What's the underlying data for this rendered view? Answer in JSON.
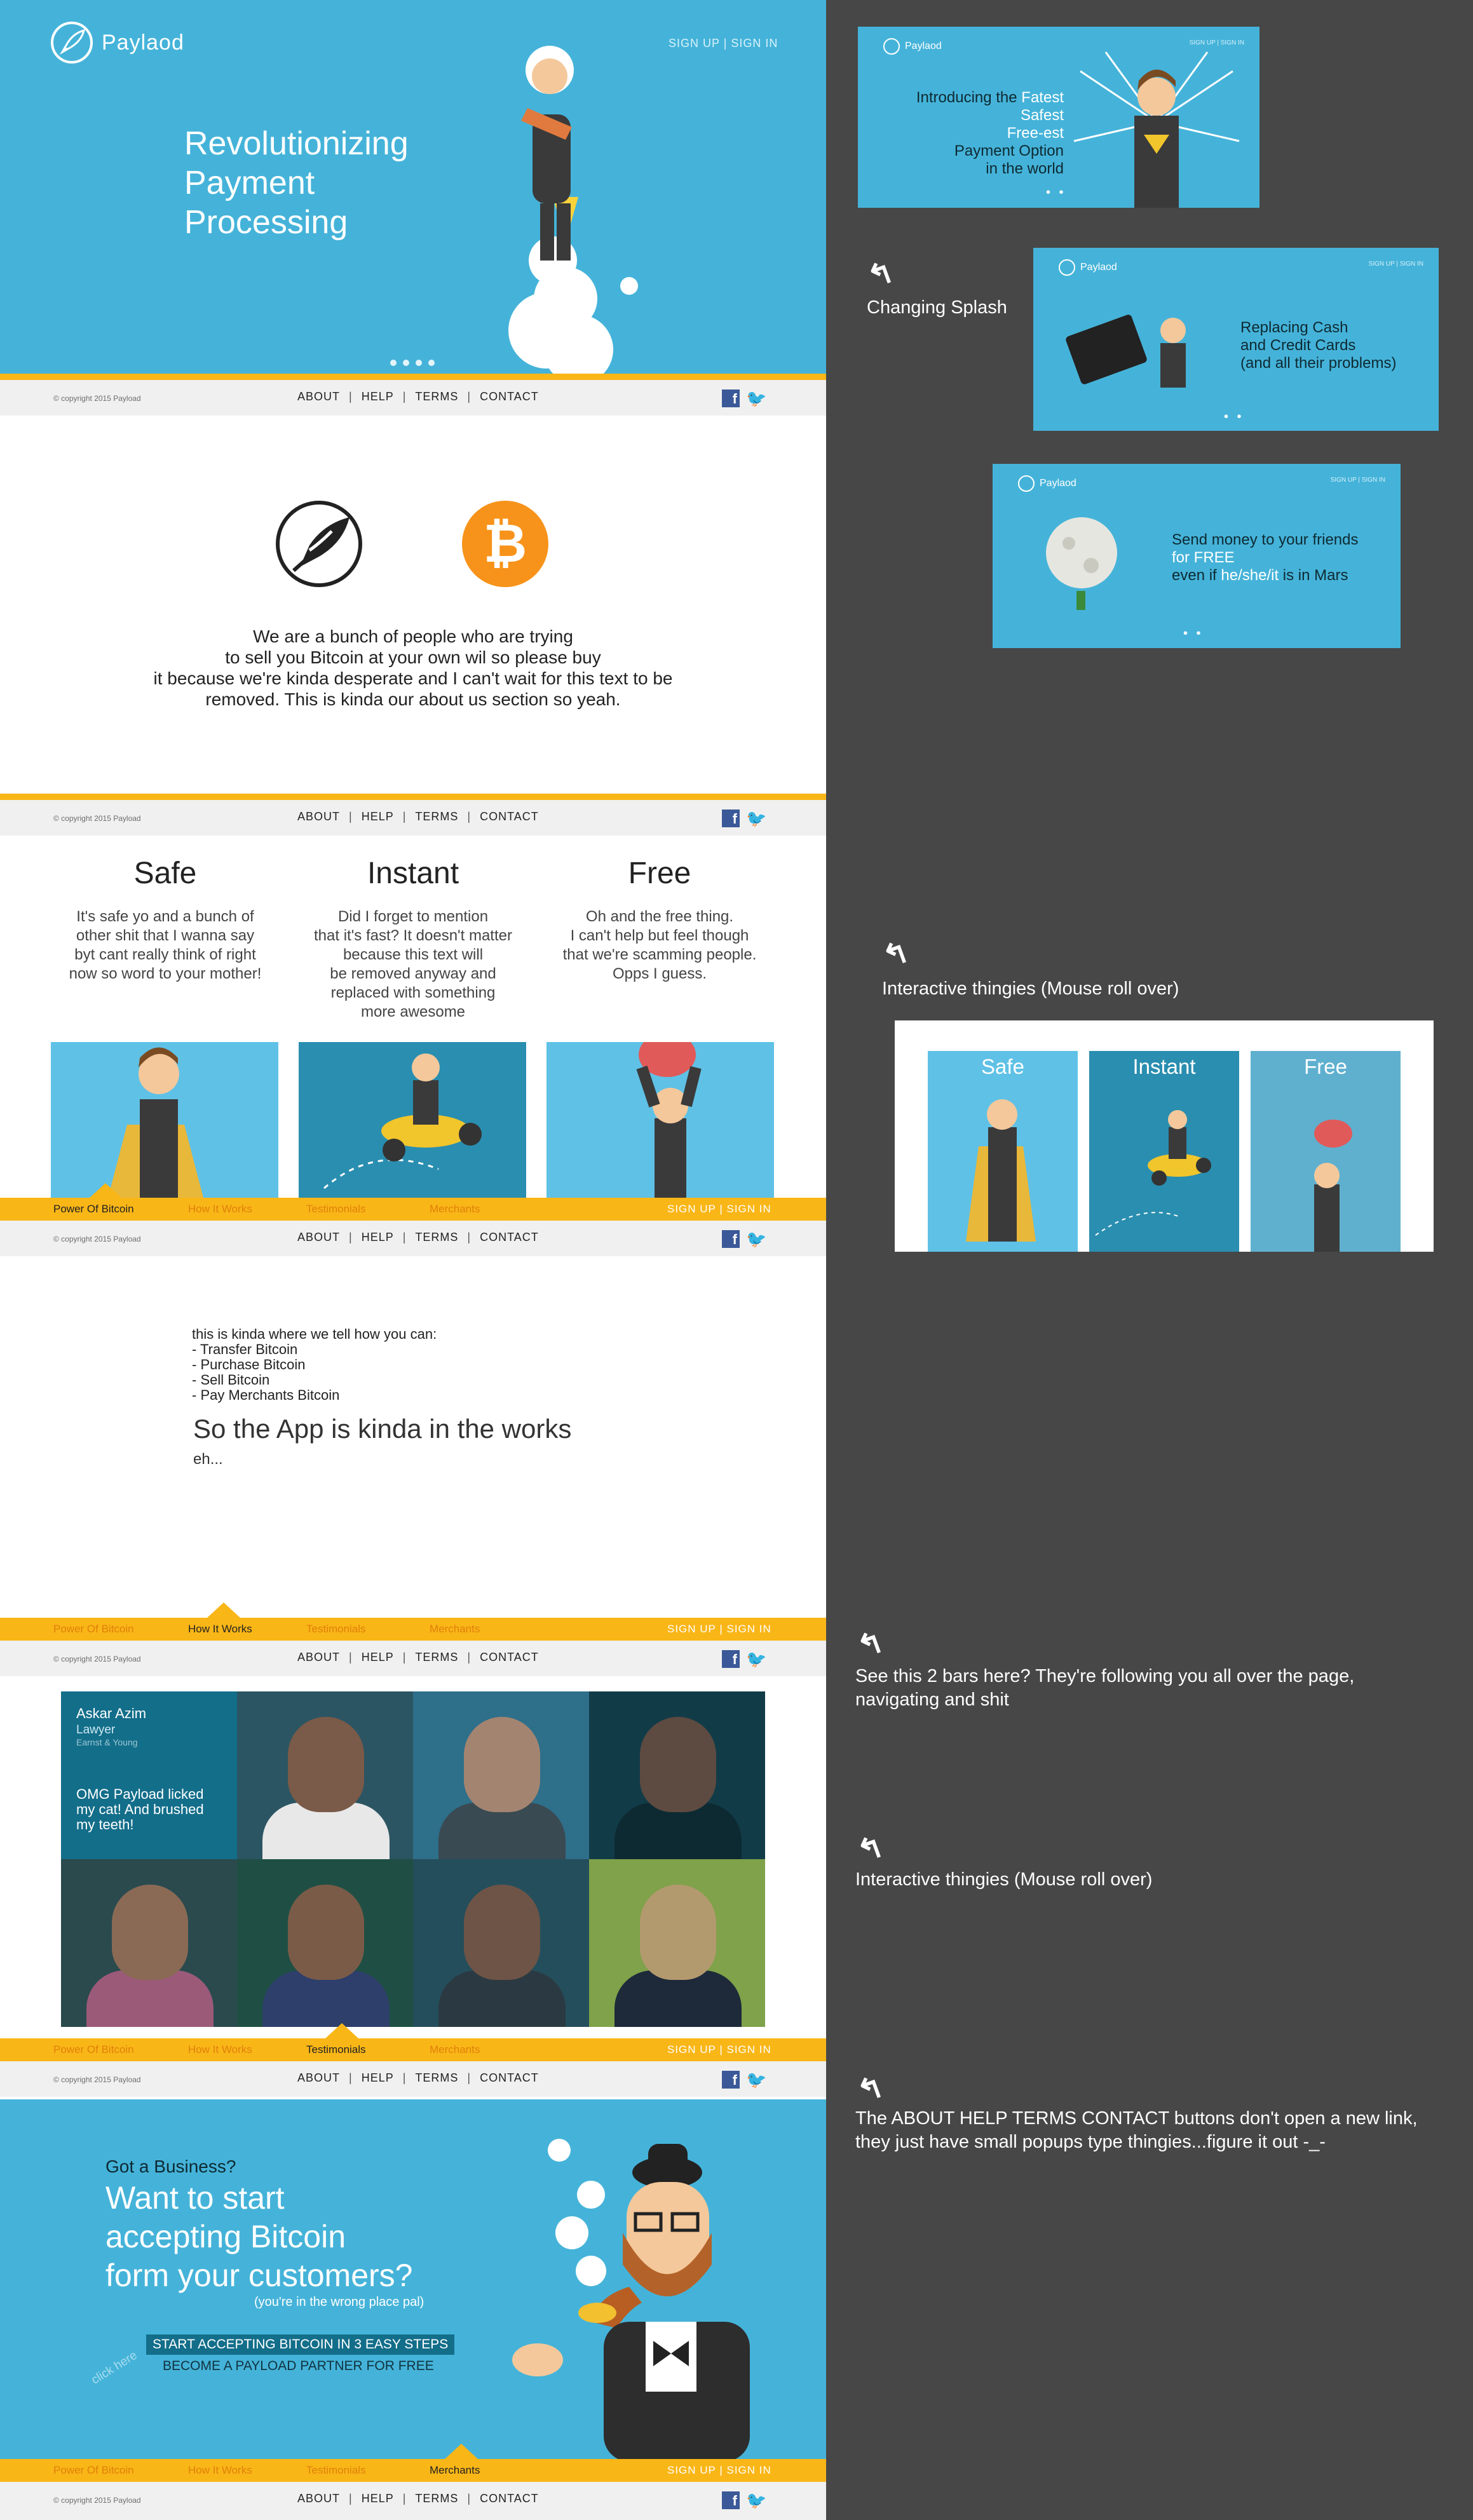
{
  "brand": {
    "name": "Paylaod"
  },
  "auth": {
    "signup": "SIGN UP",
    "signin": "SIGN IN",
    "sep": "|"
  },
  "hero": {
    "title_lines": [
      "Revolutionizing",
      "Payment",
      "Processing"
    ]
  },
  "footer": {
    "copyright": "© copyright 2015 Payload",
    "links": [
      "ABOUT",
      "HELP",
      "TERMS",
      "CONTACT"
    ]
  },
  "about": {
    "lines": [
      "We are a bunch of people who are trying",
      "to sell you Bitcoin at your own wil so please buy",
      "it because we're kinda desperate and I can't wait for this text to be",
      "removed. This is kinda our about us section so yeah."
    ]
  },
  "features": [
    {
      "title": "Safe",
      "lines": [
        "It's safe yo and a bunch of",
        "other shit that I wanna say",
        "byt cant really think of right",
        "now so word to your mother!"
      ]
    },
    {
      "title": "Instant",
      "lines": [
        "Did I forget to mention",
        "that it's fast? It doesn't matter",
        "because this text will",
        "be removed anyway and",
        "replaced with something",
        "more awesome"
      ]
    },
    {
      "title": "Free",
      "lines": [
        "Oh and the free thing.",
        "I can't help but feel though",
        "that we're scamming people.",
        "Opps I guess."
      ]
    }
  ],
  "nav": {
    "items": [
      "Power Of Bitcoin",
      "How It Works",
      "Testimonials",
      "Merchants"
    ]
  },
  "how": {
    "lines": [
      "this is kinda where we tell how you can:",
      "- Transfer Bitcoin",
      "- Purchase Bitcoin",
      "- Sell Bitcoin",
      "- Pay Merchants Bitcoin"
    ],
    "big": "So the App is kinda in the works",
    "eh": "eh..."
  },
  "testimonial": {
    "name": "Askar Azim",
    "role": "Lawyer",
    "company": "Earnst & Young",
    "quote_lines": [
      "OMG Payload licked",
      "my cat! And brushed",
      "my teeth!"
    ]
  },
  "business": {
    "small": "Got a Business?",
    "big_lines": [
      "Want to start",
      "accepting Bitcoin",
      "form your customers?"
    ],
    "note": "(you're in the wrong place pal)",
    "cta": "START ACCEPTING BITCOIN IN 3 EASY STEPS",
    "cta2": "BECOME A PAYLOAD PARTNER FOR FREE",
    "click": "click here"
  },
  "splashes": {
    "one": {
      "lines": [
        "Introducing the",
        "Fatest",
        "Safest",
        "Free-est",
        "Payment Option",
        "in the world"
      ]
    },
    "two": {
      "lines": [
        "Replacing Cash",
        "and Credit Cards",
        "(and all their problems)"
      ]
    },
    "three": {
      "line1": "Send money to your friends",
      "line2": "for FREE",
      "line3a": "even if ",
      "line3b": "he/she/it",
      "line3c": " is in Mars"
    }
  },
  "roll": {
    "labels": [
      "Safe",
      "Instant",
      "Free"
    ]
  },
  "notes": {
    "changing_splash": "Changing Splash",
    "interactive1": "Interactive thingies (Mouse roll over)",
    "bars_lines": [
      "See this 2 bars here? They're following you all over the page,",
      "navigating and shit"
    ],
    "interactive2": "Interactive thingies (Mouse roll over)",
    "buttons_lines": [
      "The ABOUT HELP TERMS CONTACT buttons don't open a new link,",
      "they just have small popups type thingies...figure it out -_-"
    ]
  },
  "colors": {
    "sky": "#45b3d9",
    "gold": "#f9b617",
    "panel_dark": "#2a8eb0",
    "bg_right": "#474747"
  },
  "icons": [
    "rocket-logo-icon",
    "bitcoin-icon",
    "facebook-icon",
    "twitter-icon",
    "arrow-icon"
  ]
}
